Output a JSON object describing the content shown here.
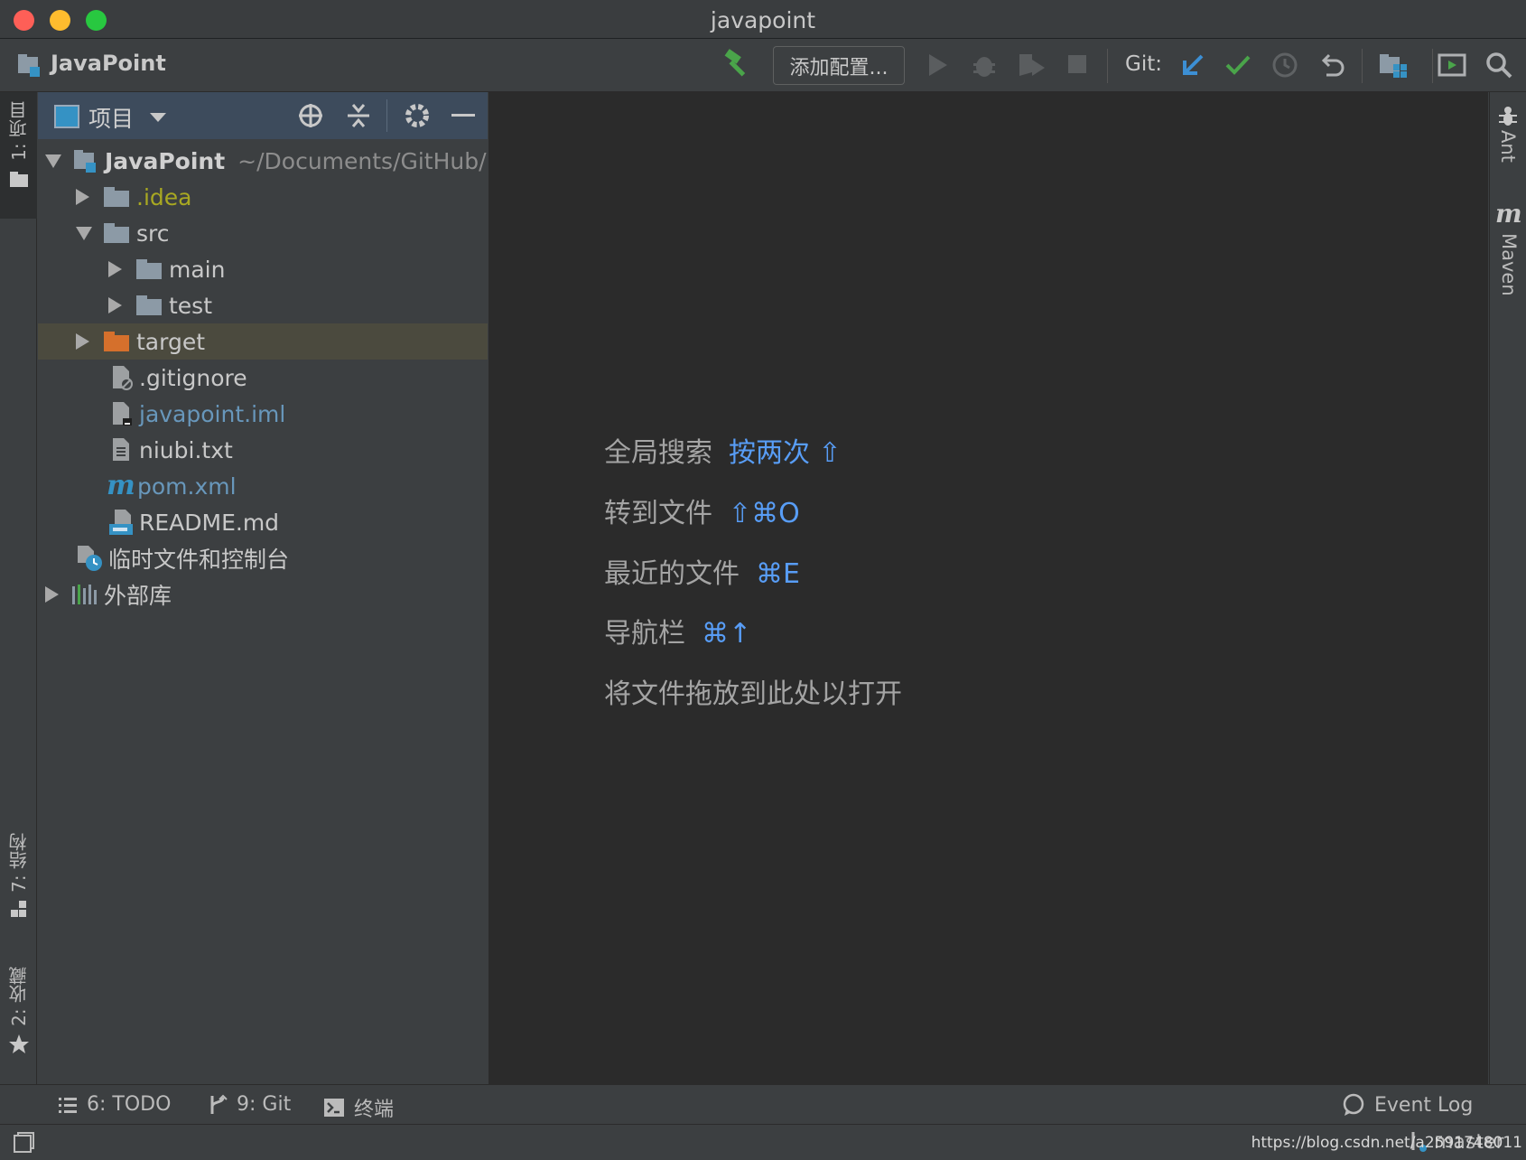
{
  "window": {
    "title": "javapoint"
  },
  "toolbar": {
    "project_name": "JavaPoint",
    "add_config_label": "添加配置...",
    "git_label": "Git:"
  },
  "left_stripe": {
    "project_tab": "1: 项目",
    "structure_tab": "7: 结构",
    "favorites_tab": "2: 收藏"
  },
  "project_panel": {
    "title": "项目",
    "tree": [
      {
        "name": "JavaPoint",
        "path": "~/Documents/GitHub/",
        "depth": 0,
        "expanded": true,
        "type": "module"
      },
      {
        "name": ".idea",
        "depth": 1,
        "expanded": false,
        "type": "folder",
        "color": "#a8a822"
      },
      {
        "name": "src",
        "depth": 1,
        "expanded": true,
        "type": "folder"
      },
      {
        "name": "main",
        "depth": 2,
        "expanded": false,
        "type": "folder"
      },
      {
        "name": "test",
        "depth": 2,
        "expanded": false,
        "type": "folder"
      },
      {
        "name": "target",
        "depth": 1,
        "expanded": false,
        "type": "folder-excluded",
        "selected": true
      },
      {
        "name": ".gitignore",
        "depth": 1,
        "type": "file"
      },
      {
        "name": "javapoint.iml",
        "depth": 1,
        "type": "file-iml",
        "color": "#6897bb"
      },
      {
        "name": "niubi.txt",
        "depth": 1,
        "type": "file"
      },
      {
        "name": "pom.xml",
        "depth": 1,
        "type": "file-maven",
        "color": "#6897bb"
      },
      {
        "name": "README.md",
        "depth": 1,
        "type": "file-md"
      },
      {
        "name": "临时文件和控制台",
        "depth": 0,
        "type": "scratch"
      },
      {
        "name": "外部库",
        "depth": 0,
        "expanded": false,
        "type": "library"
      }
    ]
  },
  "editor": {
    "hints": [
      {
        "label": "全局搜索",
        "shortcut": "按两次 ⇧"
      },
      {
        "label": "转到文件",
        "shortcut": "⇧⌘O"
      },
      {
        "label": "最近的文件",
        "shortcut": "⌘E"
      },
      {
        "label": "导航栏",
        "shortcut": "⌘↑"
      },
      {
        "label": "将文件拖放到此处以打开",
        "shortcut": ""
      }
    ]
  },
  "right_stripe": {
    "ant_tab": "Ant",
    "maven_tab": "Maven"
  },
  "bottom_tools": {
    "todo": "6: TODO",
    "git": "9: Git",
    "terminal": "终端",
    "event_log": "Event Log"
  },
  "status_bar": {
    "branch": "master",
    "watermark": "https://blog.csdn.net/a2591748011"
  }
}
